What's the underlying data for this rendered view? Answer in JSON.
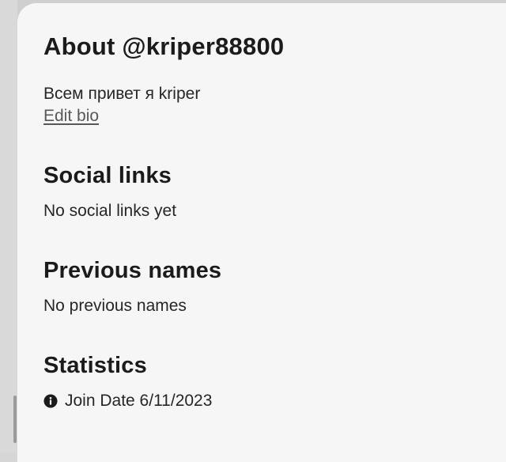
{
  "about": {
    "title": "About @kriper88800",
    "bio": "Всем привет я kriper",
    "edit_bio_label": "Edit bio"
  },
  "social_links": {
    "title": "Social links",
    "text": "No social links yet"
  },
  "previous_names": {
    "title": "Previous names",
    "text": "No previous names"
  },
  "statistics": {
    "title": "Statistics",
    "join_date": "Join Date 6/11/2023",
    "icon": "info-icon"
  },
  "colors": {
    "panel_bg": "#f6f6f6",
    "text": "#1b1b1b",
    "link": "#585858"
  }
}
